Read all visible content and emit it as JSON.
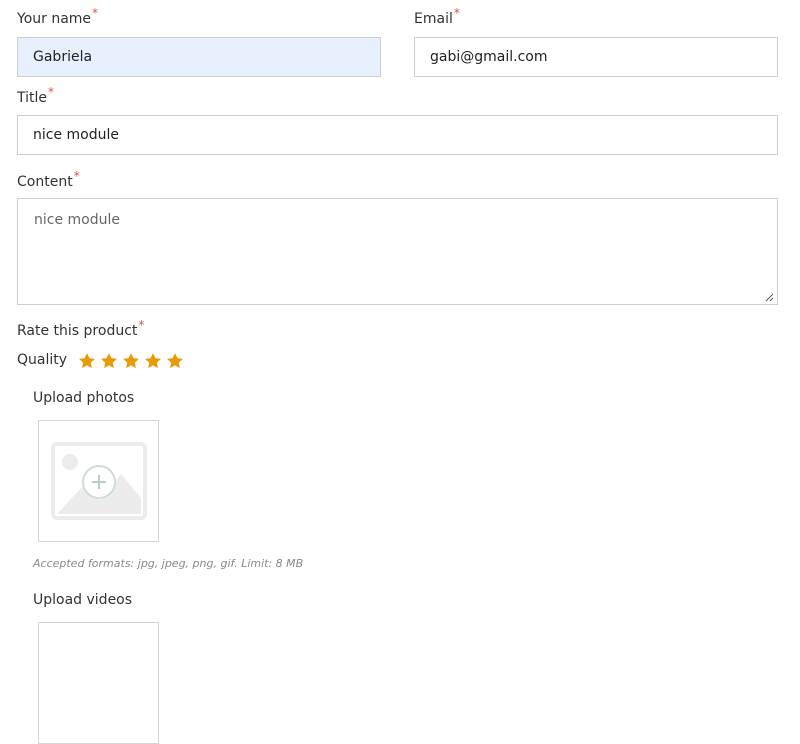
{
  "form": {
    "name": {
      "label": "Your name",
      "required": "*",
      "value": "Gabriela"
    },
    "email": {
      "label": "Email",
      "required": "*",
      "value": "gabi@gmail.com"
    },
    "title": {
      "label": "Title",
      "required": "*",
      "value": "nice module"
    },
    "content": {
      "label": "Content",
      "required": "*",
      "value": "nice module"
    },
    "rating": {
      "label": "Rate this product",
      "required": "*",
      "criteria": [
        {
          "label": "Quality",
          "stars": 5,
          "max": 5
        }
      ],
      "star_color": "#e89a0b"
    },
    "upload_photos": {
      "label": "Upload photos",
      "note": "Accepted formats: jpg, jpeg, png, gif. Limit: 8 MB",
      "icon": "add-photo-icon"
    },
    "upload_videos": {
      "label": "Upload videos"
    }
  },
  "colors": {
    "required_mark": "#d9534f",
    "autofill_bg": "#e8f0fe",
    "border": "#cfcfcf"
  }
}
